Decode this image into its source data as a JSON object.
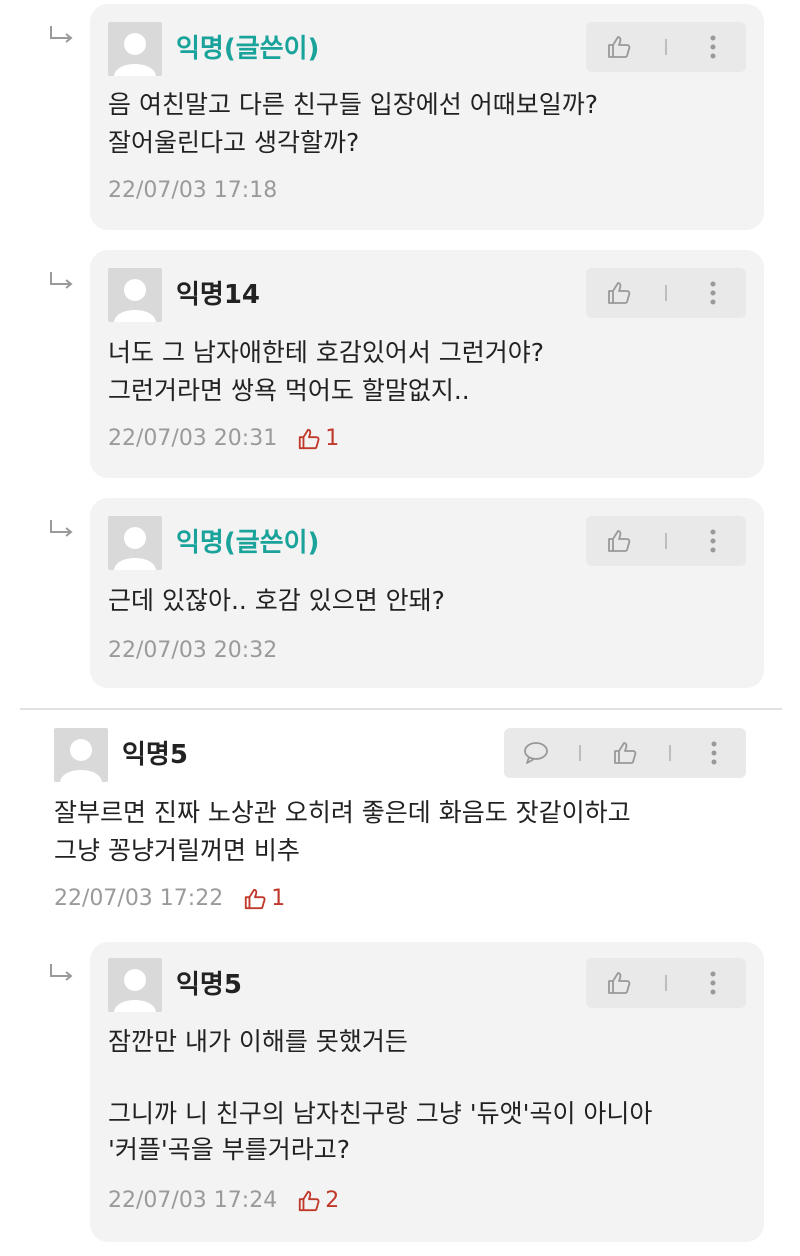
{
  "comments": [
    {
      "author": "익명(글쓴이)",
      "text": "음 여친말고 다른 친구들 입장에선 어때보일까?\n잘어울린다고 생각할까?",
      "timestamp": "22/07/03 17:18",
      "likes": ""
    },
    {
      "author": "익명14",
      "text": "너도 그 남자애한테 호감있어서 그런거야?\n그런거라면 쌍욕 먹어도 할말없지..",
      "timestamp": "22/07/03 20:31",
      "likes": "1"
    },
    {
      "author": "익명(글쓴이)",
      "text": "근데 있잖아.. 호감 있으면 안돼?",
      "timestamp": "22/07/03 20:32",
      "likes": ""
    },
    {
      "author": "익명5",
      "text": "잘부르면 진짜 노상관 오히려 좋은데 화음도 잣같이하고\n그냥 꽁냥거릴꺼면 비추",
      "timestamp": "22/07/03 17:22",
      "likes": "1"
    },
    {
      "author": "익명5",
      "text": "잠깐만 내가 이해를 못했거든\n\n그니까 니 친구의 남자친구랑 그냥 '듀앳'곡이 아니아\n'커플'곡을 부를거라고?",
      "timestamp": "22/07/03 17:24",
      "likes": "2"
    }
  ],
  "icons": {
    "reply_arrow": "reply-arrow-icon",
    "like": "thumbs-up-icon",
    "more": "more-vertical-icon",
    "comment": "comment-bubble-icon"
  },
  "colors": {
    "op_author": "#1aa39a",
    "like_active": "#c0392b",
    "meta": "#9a9a9a",
    "card_bg": "#f3f3f3"
  }
}
